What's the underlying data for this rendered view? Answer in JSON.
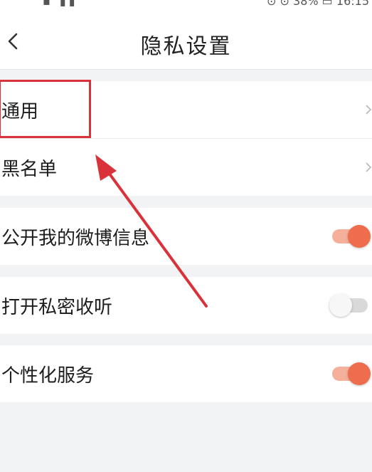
{
  "status_bar": {
    "left": "▪ ▮▮",
    "right": "⊙ ⊙ 38% ▭ 16:15"
  },
  "header": {
    "title": "隐私设置"
  },
  "sections": [
    {
      "rows": [
        {
          "label": "通用"
        },
        {
          "label": "黑名单"
        }
      ]
    },
    {
      "rows": [
        {
          "label": "公开我的微博信息",
          "toggle": "on"
        }
      ]
    },
    {
      "rows": [
        {
          "label": "打开私密收听",
          "toggle": "off"
        }
      ]
    },
    {
      "rows": [
        {
          "label": "个性化服务",
          "toggle": "on"
        }
      ]
    }
  ],
  "colors": {
    "accent": "#ee6d4d",
    "annotation": "#d9323a",
    "background": "#f2f3f5"
  },
  "icons": {
    "back": "chevron-left-icon",
    "row_arrow": "chevron-right-icon"
  }
}
